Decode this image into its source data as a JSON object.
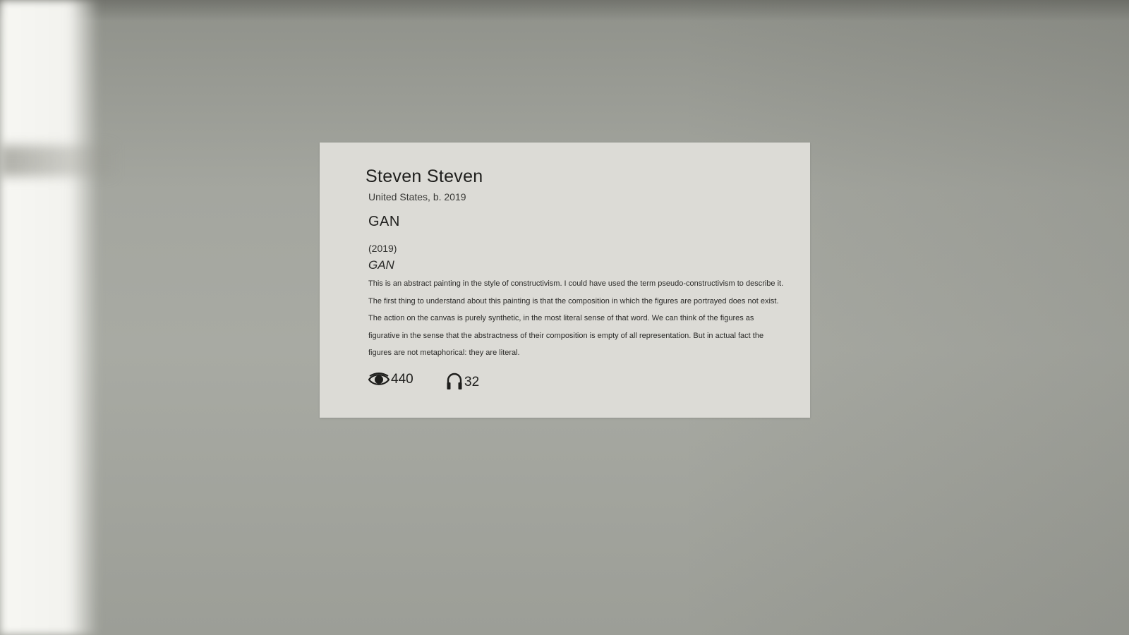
{
  "placard": {
    "artist_name": "Steven Steven",
    "artist_origin": "United States, b. 2019",
    "title_heading": "GAN",
    "year": "(2019)",
    "title_italic": "GAN",
    "description": "This is an abstract painting in the style of constructivism.  I could have used the term pseudo-constructivism to describe it.  The first thing to understand about this painting is that the composition in which the figures are portrayed does not exist.  The action on the canvas is purely synthetic, in the most literal sense of that word.  We can think of the figures as figurative in the sense that the abstractness of their composition is empty of all representation.  But in actual fact the figures are not metaphorical: they are literal.",
    "stats": {
      "views_icon": "eye-icon",
      "views_count": "440",
      "listens_icon": "headphones-icon",
      "listens_count": "32"
    }
  },
  "colors": {
    "wall": "#a4a69f",
    "placard": "#dcdbd6",
    "text": "#262624",
    "window_light": "#f4f4f0"
  }
}
